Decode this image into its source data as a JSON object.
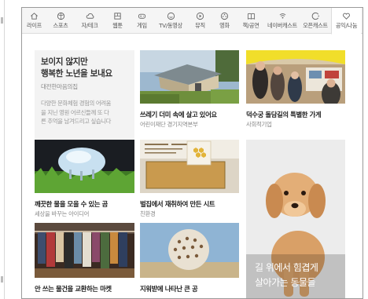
{
  "nav": [
    {
      "label": "라이프",
      "icon": "home-icon"
    },
    {
      "label": "스포츠",
      "icon": "ball-icon"
    },
    {
      "label": "자/테크",
      "icon": "cloud-icon"
    },
    {
      "label": "웹툰",
      "icon": "book-grid-icon"
    },
    {
      "label": "게임",
      "icon": "gamepad-icon"
    },
    {
      "label": "TV/동영상",
      "icon": "smile-icon"
    },
    {
      "label": "뮤직",
      "icon": "play-icon"
    },
    {
      "label": "영화",
      "icon": "film-reel-icon"
    },
    {
      "label": "책/공연",
      "icon": "open-book-icon"
    },
    {
      "label": "네이버캐스트",
      "icon": "broadcast-icon"
    },
    {
      "label": "오픈캐스트",
      "icon": "open-circle-icon"
    },
    {
      "label": "공익/나눔",
      "icon": "heart-icon"
    }
  ],
  "intro": {
    "title_line1": "보이지 않지만",
    "title_line2": "행복한 노년을 보내요",
    "subtitle": "대전한마음의집",
    "desc_line1": "다양한 문화체험 경험의 어려움",
    "desc_line2": "을 지닌 영원 어르신들께 또 다",
    "desc_line3": "른 추억을 남겨드리고 싶습니다"
  },
  "cards": [
    {
      "title": "쓰레기 더미 속에 살고 있어요",
      "sub": "어린이재단 경기지역본부"
    },
    {
      "title": "덕수궁 돌담길의 특별한 가게",
      "sub": "사회적기업"
    },
    {
      "title": "깨끗한 물을 모을 수 있는 곰",
      "sub": "세상을 바꾸는 아이디어"
    },
    {
      "title": "벌집에서 재취하여 만든 시트",
      "sub": "친환경"
    },
    {
      "title": "안 쓰는 물건을 교환하는 마켓",
      "sub": ""
    },
    {
      "title": "지워받에 나타난 큰 공",
      "sub": ""
    }
  ],
  "featured": {
    "line1": "길 위에서 힘겹게",
    "line2": "살아가는 동물들"
  },
  "colors": {
    "nav_bg": "#f5f5f5",
    "intro_bg": "#f3f3f3",
    "frame_border": "#9a9a9a"
  }
}
